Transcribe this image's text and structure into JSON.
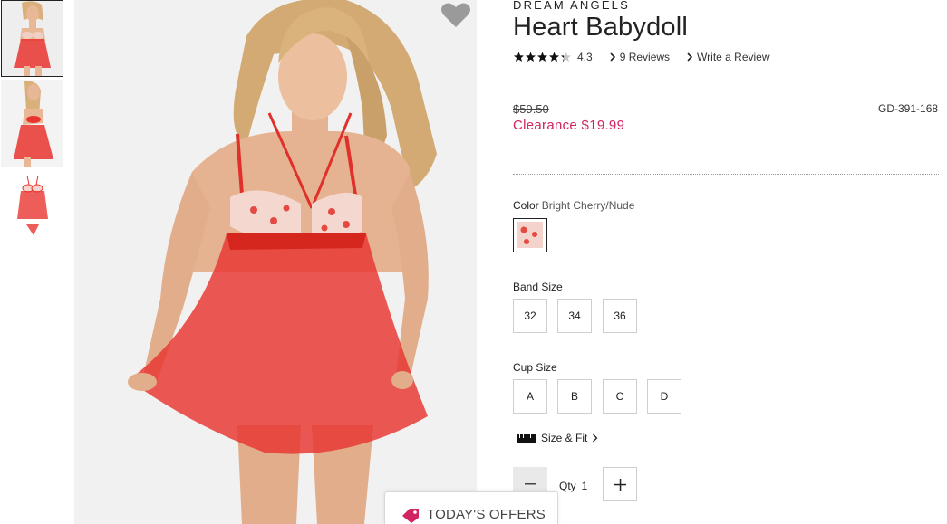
{
  "product": {
    "brand": "DREAM ANGELS",
    "title": "Heart Babydoll",
    "rating": "4.3",
    "rating_value": 4.3,
    "reviews_link": "9 Reviews",
    "write_review_link": "Write a Review",
    "original_price": "$59.50",
    "sale_price": "Clearance $19.99",
    "sku": "GD-391-168"
  },
  "color": {
    "label": "Color",
    "selected": "Bright Cherry/Nude"
  },
  "band_size": {
    "label": "Band Size",
    "options": [
      "32",
      "34",
      "36"
    ]
  },
  "cup_size": {
    "label": "Cup Size",
    "options": [
      "A",
      "B",
      "C",
      "D"
    ]
  },
  "size_fit": {
    "label": "Size & Fit"
  },
  "quantity": {
    "label": "Qty",
    "value": "1"
  },
  "offers": {
    "label": "TODAY'S OFFERS"
  },
  "colors": {
    "accent_pink": "#d12361",
    "garment_red": "#e8342f",
    "skin": "#e9b99a"
  },
  "icons": {
    "favorite": "heart-icon",
    "size_fit": "ruler-icon",
    "offers": "tag-icon"
  }
}
